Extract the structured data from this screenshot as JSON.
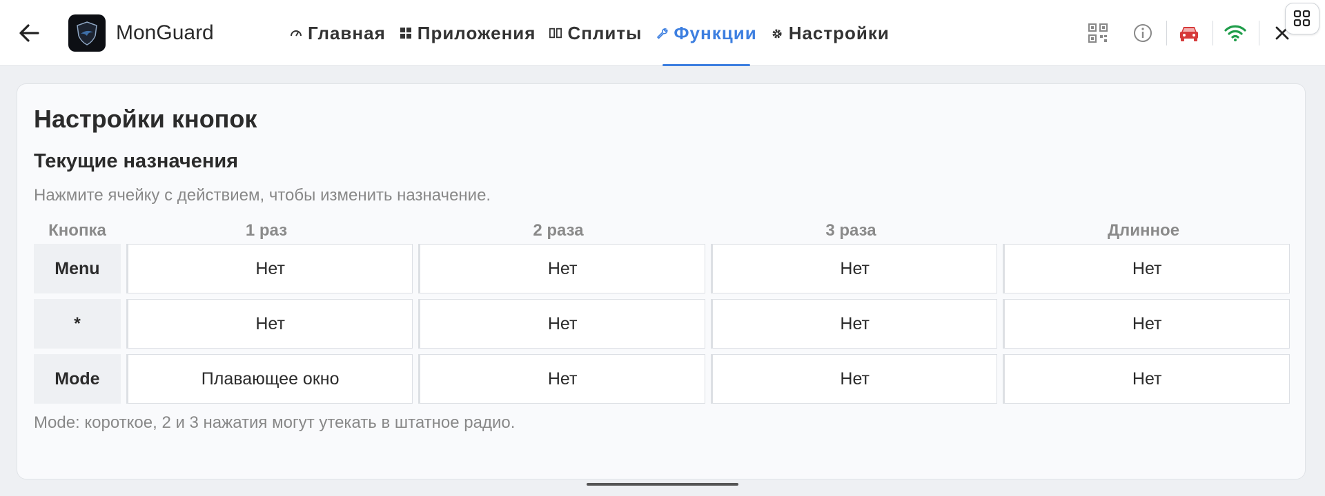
{
  "header": {
    "app_title": "MonGuard",
    "tabs": [
      {
        "label": "Главная",
        "icon": "gauge-icon"
      },
      {
        "label": "Приложения",
        "icon": "apps-grid-icon"
      },
      {
        "label": "Сплиты",
        "icon": "split-columns-icon"
      },
      {
        "label": "Функции",
        "icon": "wrench-icon",
        "active": true
      },
      {
        "label": "Настройки",
        "icon": "gear-icon"
      }
    ],
    "right_icons": [
      "qr-code-icon",
      "info-icon",
      "car-icon",
      "wifi-icon",
      "close-icon"
    ],
    "colors": {
      "accent": "#3d7fe0",
      "car": "#d63a3a",
      "wifi": "#1f9d4a"
    }
  },
  "card": {
    "title": "Настройки кнопок",
    "section_title": "Текущие назначения",
    "hint": "Нажмите ячейку с действием, чтобы изменить назначение.",
    "footnote": "Mode: короткое, 2 и 3 нажатия могут утекать в штатное радио."
  },
  "table": {
    "columns": [
      "Кнопка",
      "1 раз",
      "2 раза",
      "3 раза",
      "Длинное"
    ],
    "rows": [
      {
        "key": "Menu",
        "cells": [
          "Нет",
          "Нет",
          "Нет",
          "Нет"
        ]
      },
      {
        "key": "*",
        "cells": [
          "Нет",
          "Нет",
          "Нет",
          "Нет"
        ]
      },
      {
        "key": "Mode",
        "cells": [
          "Плавающее окно",
          "Нет",
          "Нет",
          "Нет"
        ]
      }
    ]
  }
}
